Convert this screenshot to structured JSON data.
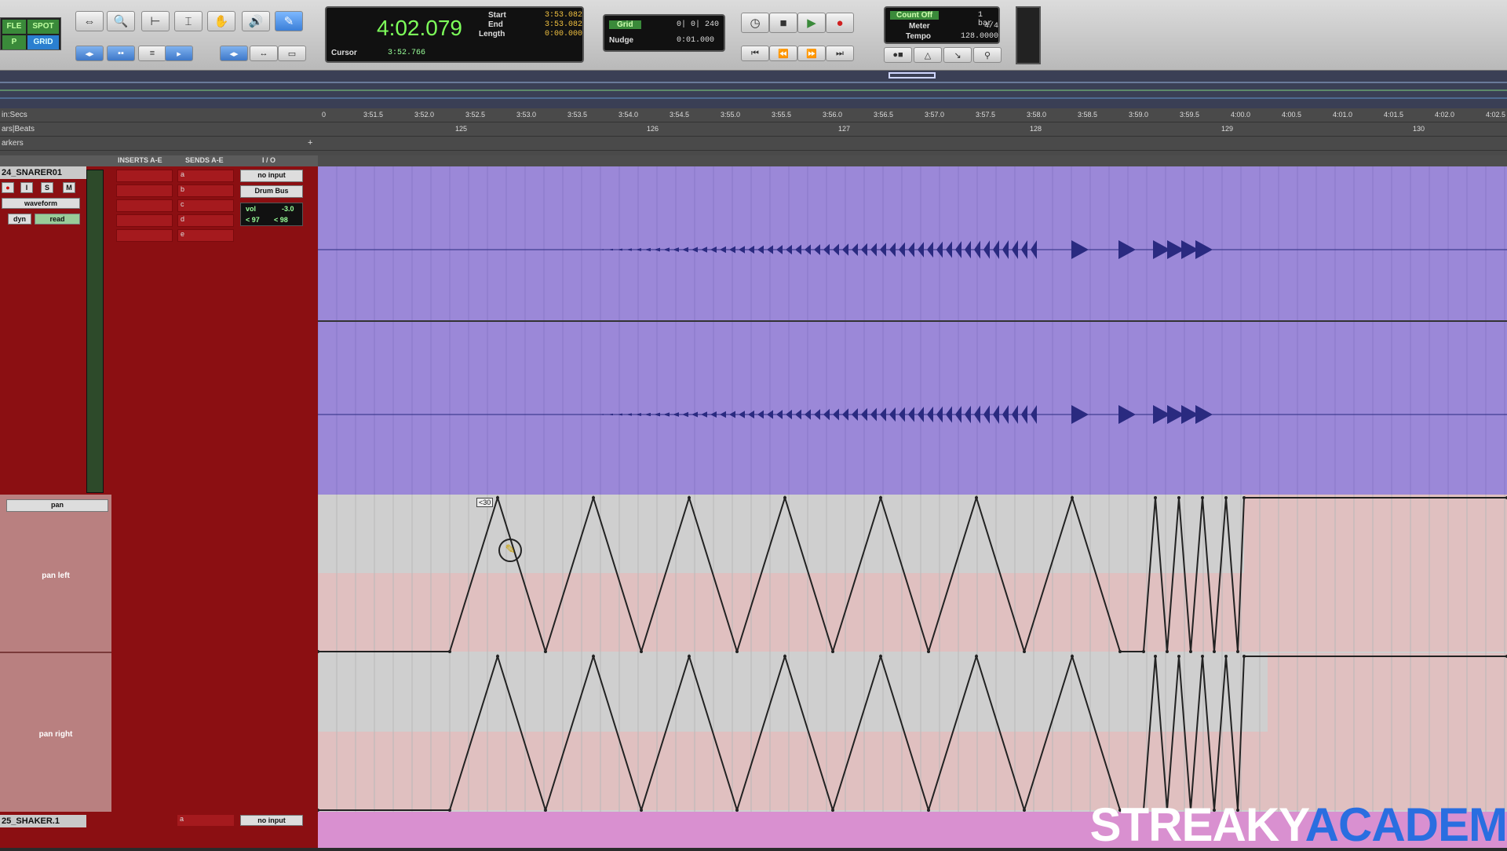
{
  "toolbar": {
    "mode_buttons": [
      "FLE",
      "SPOT",
      "P",
      "GRID"
    ],
    "main_counter": "4:02.079",
    "selection": {
      "start_label": "Start",
      "start": "3:53.082",
      "end_label": "End",
      "end": "3:53.082",
      "length_label": "Length",
      "length": "0:00.000"
    },
    "cursor_label": "Cursor",
    "cursor_value": "3:52.766",
    "grid_label": "Grid",
    "grid_value": "0| 0| 240",
    "nudge_label": "Nudge",
    "nudge_value": "0:01.000",
    "count_off": "Count Off",
    "count_off_value": "1 bar",
    "meter_label": "Meter",
    "meter_value": "4/4",
    "tempo_label": "Tempo",
    "tempo_value": "128.0000"
  },
  "rulers": {
    "min_secs_label": "in:Secs",
    "bars_label": "ars|Beats",
    "markers_label": "arkers",
    "time_ticks": [
      "0",
      "3:51.5",
      "3:52.0",
      "3:52.5",
      "3:53.0",
      "3:53.5",
      "3:54.0",
      "3:54.5",
      "3:55.0",
      "3:55.5",
      "3:56.0",
      "3:56.5",
      "3:57.0",
      "3:57.5",
      "3:58.0",
      "3:58.5",
      "3:59.0",
      "3:59.5",
      "4:00.0",
      "4:00.5",
      "4:01.0",
      "4:01.5",
      "4:02.0",
      "4:02.5"
    ],
    "bar_ticks": [
      "125",
      "126",
      "127",
      "128",
      "129",
      "130"
    ]
  },
  "columns": {
    "inserts": "INSERTS A-E",
    "sends": "SENDS A-E",
    "io": "I / O"
  },
  "track": {
    "name": "24_SNARER01",
    "view": "waveform",
    "dyn": "dyn",
    "read": "read",
    "sends": [
      "a",
      "b",
      "c",
      "d",
      "e"
    ],
    "input": "no input",
    "output": "Drum Bus",
    "vol_label": "vol",
    "vol_value": "-3.0",
    "pan_left_value": "< 97",
    "pan_right_value": "< 98",
    "automation_select": "pan",
    "lane_left": "pan left",
    "lane_right": "pan right",
    "breakpoint_tooltip": "<30"
  },
  "track2": {
    "name": "25_SHAKER.1",
    "send": "a",
    "input": "no input"
  },
  "watermark": {
    "part1": "STREAKY",
    "part2": "ACADEM"
  },
  "colors": {
    "waveform_bg": "#9b88d8",
    "wave": "#2a2a80",
    "track_panel": "#8b0f12",
    "lane_bg": "#cfcfcf"
  }
}
